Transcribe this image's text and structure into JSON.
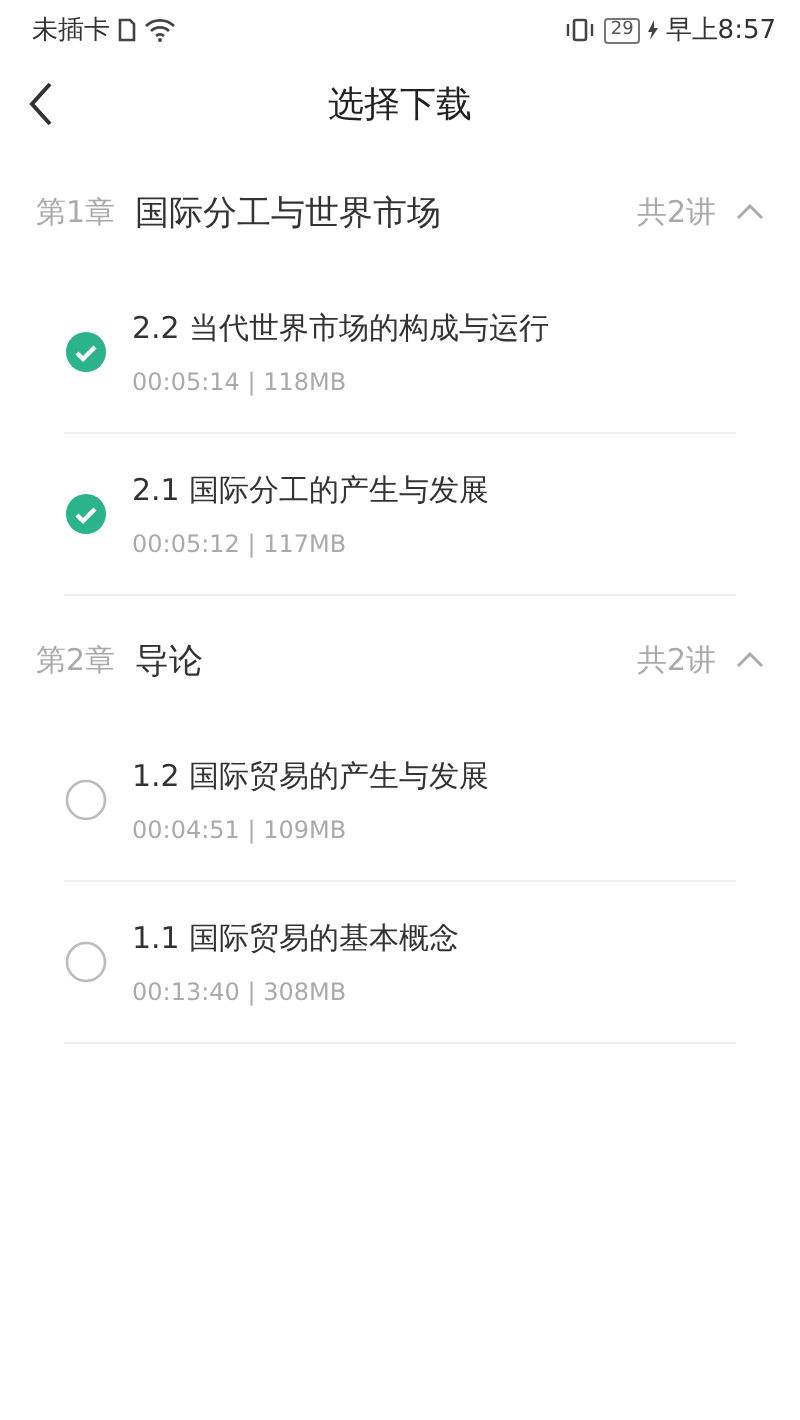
{
  "status_bar": {
    "carrier": "未插卡",
    "battery": "29",
    "time": "早上8:57"
  },
  "header": {
    "title": "选择下载"
  },
  "chapters": [
    {
      "number": "第1章",
      "title": "国际分工与世界市场",
      "count": "共2讲",
      "expanded": true,
      "lessons": [
        {
          "title": "2.2 当代世界市场的构成与运行",
          "meta": "00:05:14 | 118MB",
          "checked": true
        },
        {
          "title": "2.1 国际分工的产生与发展",
          "meta": "00:05:12 | 117MB",
          "checked": true
        }
      ]
    },
    {
      "number": "第2章",
      "title": "导论",
      "count": "共2讲",
      "expanded": true,
      "lessons": [
        {
          "title": "1.2 国际贸易的产生与发展",
          "meta": "00:04:51 | 109MB",
          "checked": false
        },
        {
          "title": "1.1 国际贸易的基本概念",
          "meta": "00:13:40 | 308MB",
          "checked": false
        }
      ]
    }
  ]
}
